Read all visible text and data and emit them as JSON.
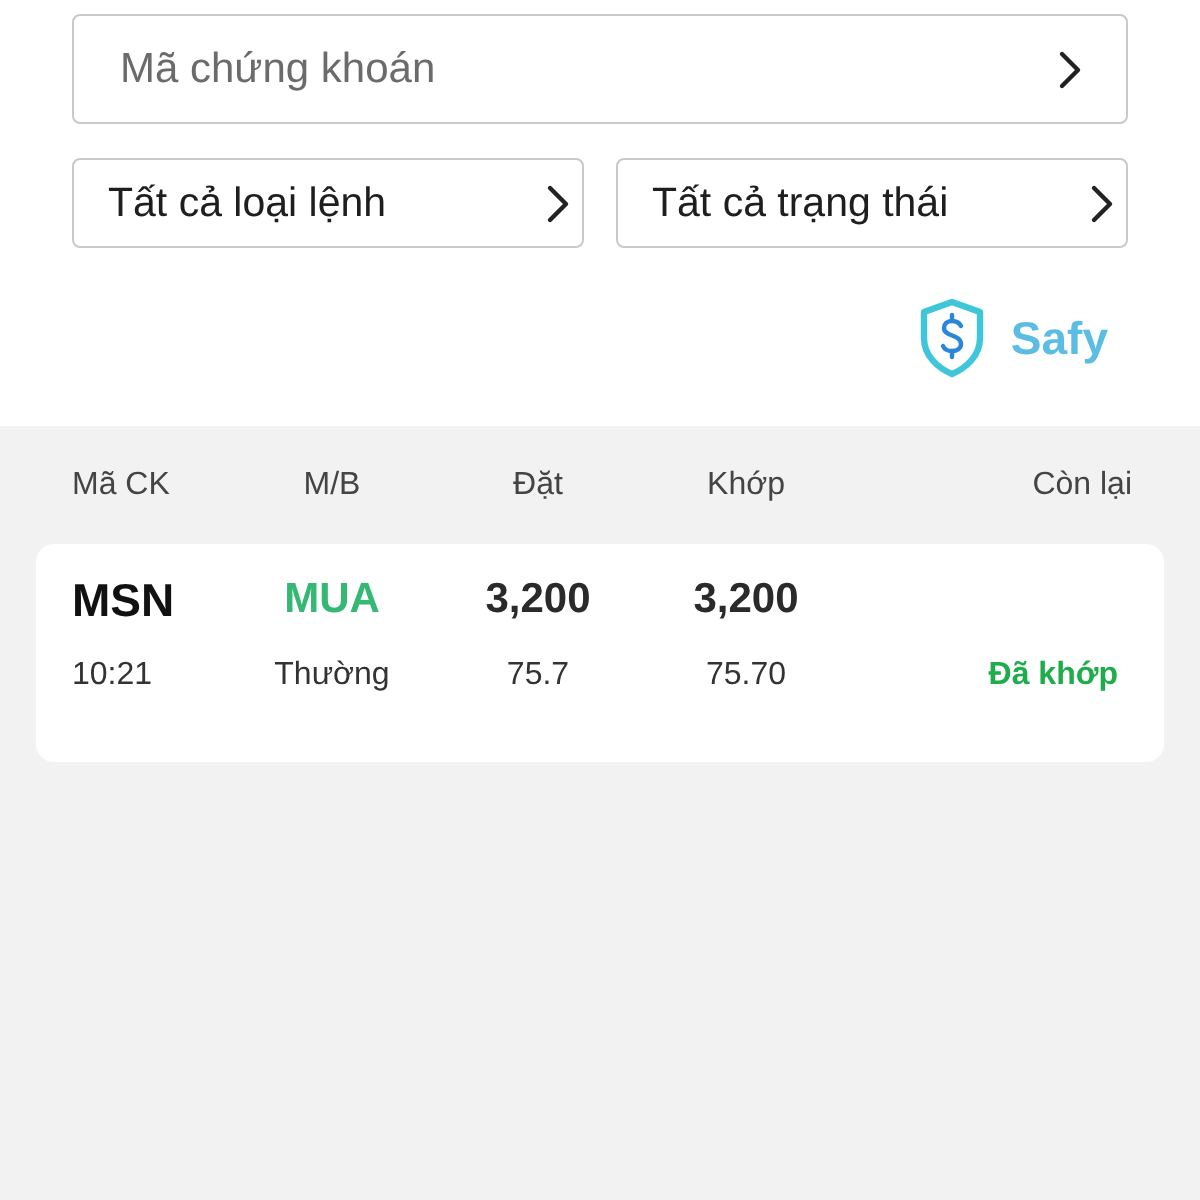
{
  "filters": {
    "symbol_field": {
      "placeholder": "Mã chứng khoán"
    },
    "dropdowns": [
      {
        "label": "Tất cả loại lệnh"
      },
      {
        "label": "Tất cả trạng thái"
      }
    ]
  },
  "brand": {
    "name": "Safy"
  },
  "table": {
    "columns": [
      "Mã CK",
      "M/B",
      "Đặt",
      "Khớp",
      "Còn lại"
    ],
    "rows": [
      {
        "symbol": "MSN",
        "side": {
          "label": "MUA",
          "kind": "buy"
        },
        "quantity": "3,200",
        "matched_quantity": "3,200",
        "time": "10:21",
        "order_type": "Thường",
        "price": "75.7",
        "matched_price": "75.70",
        "status": {
          "label": "Đã khớp",
          "kind": "matched"
        }
      }
    ]
  }
}
